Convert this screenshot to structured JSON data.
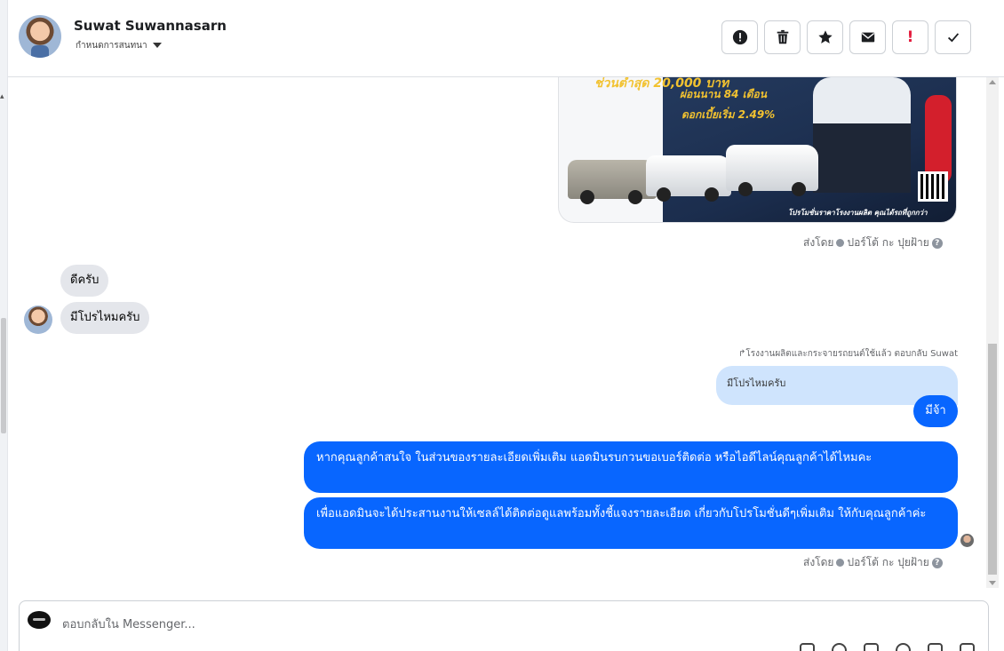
{
  "header": {
    "contact_name": "Suwat Suwannasarn",
    "assign_label": "กำหนดการสนทนา"
  },
  "actions": [
    {
      "name": "report-spam-button",
      "icon": "alert-circle-icon"
    },
    {
      "name": "delete-button",
      "icon": "trash-icon"
    },
    {
      "name": "star-button",
      "icon": "star-icon"
    },
    {
      "name": "mark-unread-button",
      "icon": "envelope-icon"
    },
    {
      "name": "follow-up-button",
      "icon": "exclamation-icon",
      "label": "!"
    },
    {
      "name": "mark-done-button",
      "icon": "checkmark-icon"
    }
  ],
  "promo": {
    "headline": "ช่วนต่ำสุด 20,000 บาท",
    "installment": "ผ่อนนาน 84 เดือน",
    "interest": "ดอกเบี้ยเริ่ม 2.49%",
    "footer": "โปรโมชั่นราคาโรงงานผลิต คุณได้รถที่ถูกกว่า"
  },
  "sent_by_1": {
    "prefix": "ส่งโดย",
    "sender": "ปอร์โต้ กะ ปุยฝ้าย",
    "help": "?"
  },
  "incoming": {
    "msg1": "ดีครับ",
    "msg2": "มีโปรไหมครับ"
  },
  "reply": {
    "note": "โรงงานผลิตและกระจายรถยนต์ใช้แล้ว ตอบกลับ Suwat",
    "quoted": "มีโปรไหมครับ",
    "answer": "มีจ้า"
  },
  "outgoing": {
    "msg1": "หากคุณลูกค้าสนใจ ในส่วนของรายละเอียดเพิ่มเติม แอดมินรบกวนขอเบอร์ติดต่อ หรือไอดีไลน์คุณลูกค้าได้ไหมคะ",
    "msg2": "เพื่อแอดมินจะได้ประสานงานให้เซลล์ได้ติดต่อดูแลพร้อมทั้งชี้แจงรายละเอียด เกี่ยวกับโปรโมชั่นดีๆเพิ่มเติม ให้กับคุณลูกค้าค่ะ"
  },
  "sent_by_2": {
    "prefix": "ส่งโดย",
    "sender": "ปอร์โต้ กะ ปุยฝ้าย",
    "help": "?"
  },
  "composer": {
    "placeholder": "ตอบกลับใน Messenger..."
  },
  "colors": {
    "outgoing_bubble": "#0866ff",
    "incoming_bubble": "#e4e6eb",
    "quoted_bubble": "#cfe4fd",
    "follow_up_red": "#e41e3f"
  }
}
